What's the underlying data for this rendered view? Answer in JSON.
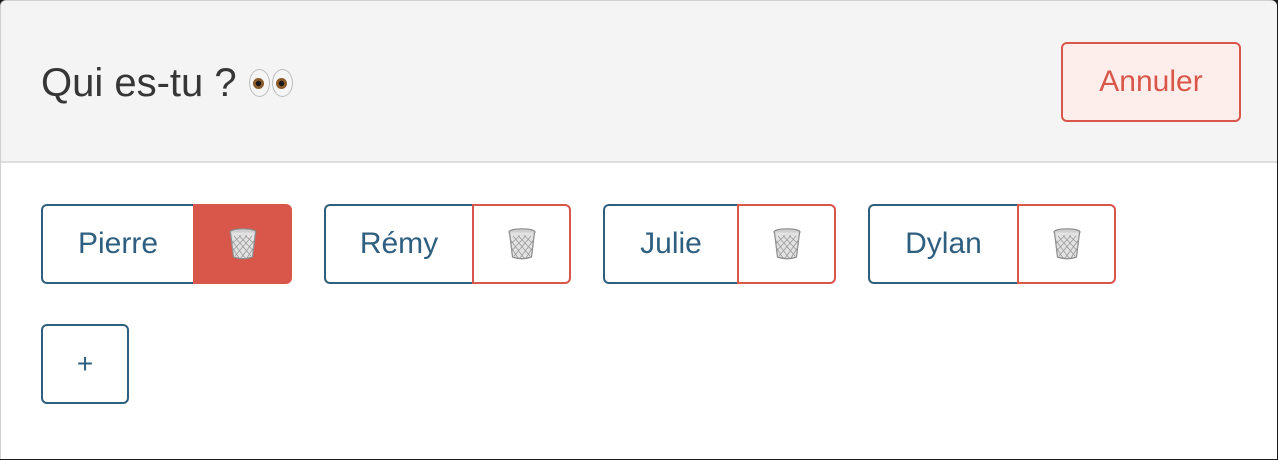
{
  "header": {
    "title": "Qui es-tu ?",
    "cancel_label": "Annuler"
  },
  "users": [
    {
      "name": "Pierre",
      "delete_icon": "wastebasket-icon",
      "delete_active": true
    },
    {
      "name": "Rémy",
      "delete_icon": "wastebasket-icon",
      "delete_active": false
    },
    {
      "name": "Julie",
      "delete_icon": "wastebasket-icon",
      "delete_active": false
    },
    {
      "name": "Dylan",
      "delete_icon": "wastebasket-icon",
      "delete_active": false
    }
  ],
  "add_label": "+",
  "colors": {
    "primary": "#2f5f80",
    "danger": "#d9574a",
    "danger_light": "#fdeeec",
    "header_bg": "#f4f4f4"
  }
}
